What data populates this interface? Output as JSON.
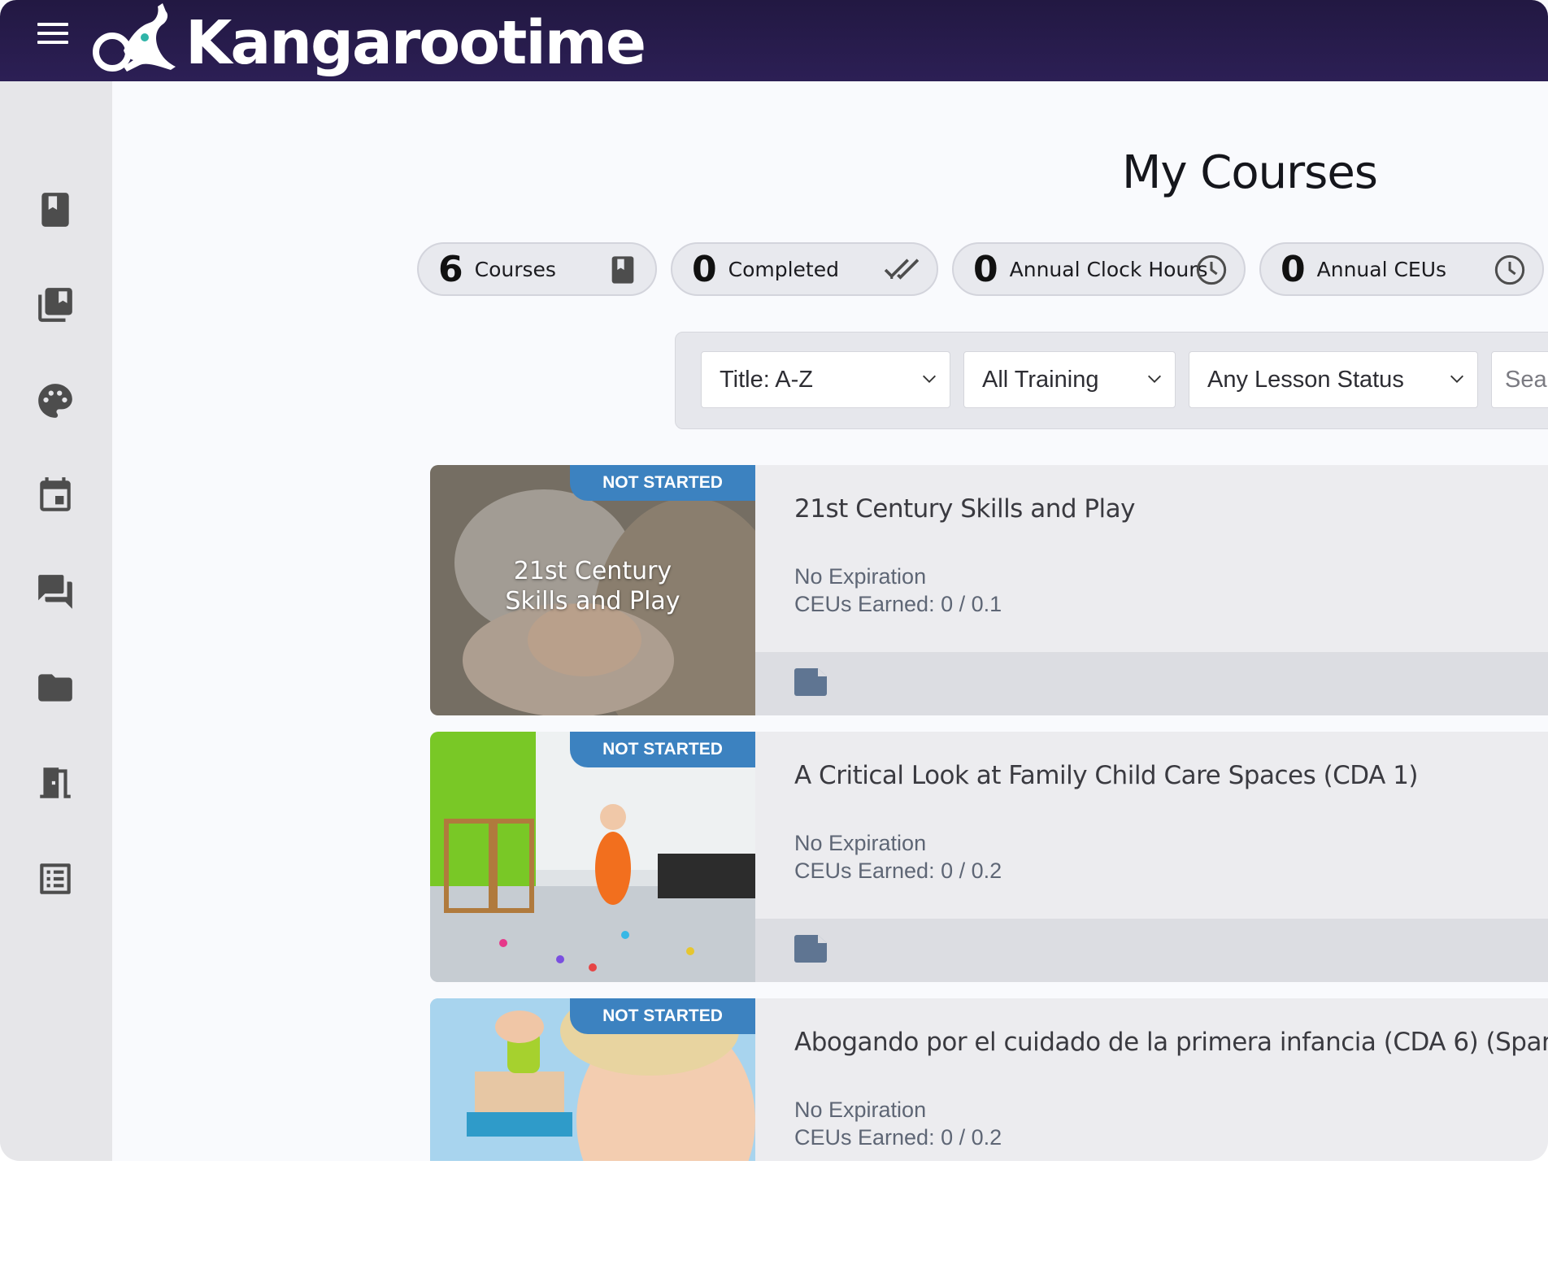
{
  "app": {
    "brand": "Kangarootime"
  },
  "page": {
    "title": "My Courses"
  },
  "stats": [
    {
      "value": "6",
      "label": "Courses",
      "icon": "book-icon"
    },
    {
      "value": "0",
      "label": "Completed",
      "icon": "double-check-icon"
    },
    {
      "value": "0",
      "label": "Annual Clock Hours",
      "icon": "clock-icon"
    },
    {
      "value": "0",
      "label": "Annual CEUs",
      "icon": "clock-icon"
    }
  ],
  "filters": {
    "sort": "Title: A-Z",
    "training": "All Training",
    "lesson_status": "Any Lesson Status",
    "search_placeholder": "Sea"
  },
  "sidebar": {
    "icons": [
      "book-icon",
      "library-icon",
      "palette-icon",
      "calendar-icon",
      "forum-icon",
      "folder-icon",
      "door-exit-icon",
      "list-icon"
    ]
  },
  "courses": [
    {
      "status": "NOT STARTED",
      "title": "21st Century Skills and Play",
      "thumb_text_1": "21st Century",
      "thumb_text_2": "Skills and Play",
      "expiration": "No Expiration",
      "ceus": "CEUs Earned: 0 / 0.1"
    },
    {
      "status": "NOT STARTED",
      "title": "A Critical Look at Family Child Care Spaces (CDA 1)",
      "expiration": "No Expiration",
      "ceus": "CEUs Earned: 0 / 0.2"
    },
    {
      "status": "NOT STARTED",
      "title": "Abogando por el cuidado de la primera infancia (CDA 6) (Span",
      "expiration": "No Expiration",
      "ceus": "CEUs Earned: 0 / 0.2"
    }
  ],
  "colors": {
    "topbar": "#221842",
    "badge": "#3c82c0",
    "sidebar": "#e6e6e9",
    "doc_icon": "#5f7592"
  }
}
